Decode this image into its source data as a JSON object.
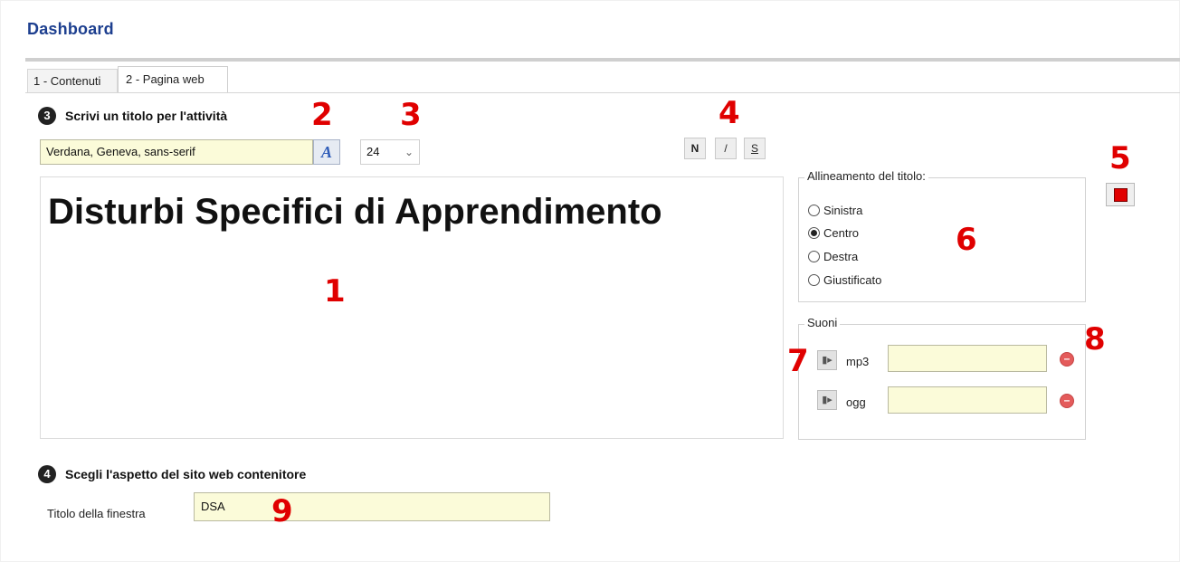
{
  "header": {
    "title": "Dashboard"
  },
  "tabs": [
    {
      "label": "1 - Contenuti",
      "active": false
    },
    {
      "label": "2 - Pagina web",
      "active": true
    }
  ],
  "section3": {
    "number": "3",
    "label": "Scrivi un titolo per l'attività",
    "font_family_value": "Verdana, Geneva, sans-serif",
    "font_size_value": "24",
    "format_buttons": {
      "bold": "N",
      "italic": "/",
      "strike": "S"
    },
    "title_text": "Disturbi Specifici di Apprendimento",
    "title_color": "#e10000"
  },
  "alignment": {
    "legend": "Allineamento del titolo:",
    "options": [
      "Sinistra",
      "Centro",
      "Destra",
      "Giustificato"
    ],
    "selected": "Centro"
  },
  "sounds": {
    "legend": "Suoni",
    "items": [
      {
        "label": "mp3",
        "value": ""
      },
      {
        "label": "ogg",
        "value": ""
      }
    ]
  },
  "section4": {
    "number": "4",
    "label": "Scegli l'aspetto del sito web contenitore",
    "window_title_label": "Titolo della finestra",
    "window_title_value": "DSA"
  },
  "callouts": [
    "1",
    "2",
    "3",
    "4",
    "5",
    "6",
    "7",
    "8",
    "9"
  ],
  "colors": {
    "accent": "#1d3f8f",
    "field_bg": "#fbfbd9",
    "callout": "#e00000"
  },
  "icons": {
    "font_picker": "font-a-icon",
    "speaker": "speaker-icon",
    "remove": "remove-circle-icon",
    "dropdown": "chevron-down-icon"
  }
}
